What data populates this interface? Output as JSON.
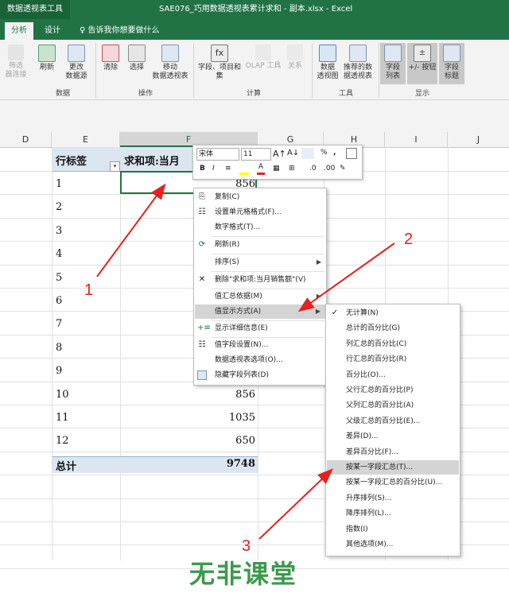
{
  "titlebar": {
    "context_tab": "数据透视表工具",
    "title": "SAE076_巧用数据透视表累计求和 - 副本.xlsx  -  Excel"
  },
  "tabs": {
    "analyze": "分析",
    "design": "设计",
    "tell_me": "告诉我你想要做什么"
  },
  "ribbon": {
    "filter_connections": "筛选\n器连接",
    "refresh": "刷新",
    "change_source": "更改\n数据源",
    "clear": "清除",
    "select": "选择",
    "move_pivot": "移动\n数据透视表",
    "fields_items_sets": "字段、项目和\n集",
    "olap_tools": "OLAP 工具",
    "relationships": "关系",
    "pivot_chart": "数据\n透视图",
    "recommended_pivot": "推荐的数\n据透视表",
    "field_list": "字段\n列表",
    "buttons": "+/- 按钮",
    "field_headers": "字段\n标题",
    "group_data": "数据",
    "group_actions": "操作",
    "group_calc": "计算",
    "group_tools": "工具",
    "group_show": "显示"
  },
  "columns": [
    "D",
    "E",
    "F",
    "G",
    "H",
    "I",
    "J"
  ],
  "pivot": {
    "row_label": "行标签",
    "value_header": "求和项:当月",
    "rows": [
      {
        "label": "1",
        "value": "856"
      },
      {
        "label": "2",
        "value": ""
      },
      {
        "label": "3",
        "value": ""
      },
      {
        "label": "4",
        "value": ""
      },
      {
        "label": "5",
        "value": ""
      },
      {
        "label": "6",
        "value": ""
      },
      {
        "label": "7",
        "value": ""
      },
      {
        "label": "8",
        "value": ""
      },
      {
        "label": "9",
        "value": ""
      },
      {
        "label": "10",
        "value": "856"
      },
      {
        "label": "11",
        "value": "1035"
      },
      {
        "label": "12",
        "value": "650"
      }
    ],
    "total_label": "总计",
    "total_value": "9748"
  },
  "minibar": {
    "font": "宋体",
    "size": "11",
    "bold": "B",
    "italic": "I",
    "percent": "%",
    "comma": ","
  },
  "context_menu": {
    "copy": "复制(C)",
    "format_cells": "设置单元格格式(F)...",
    "number_format": "数字格式(T)...",
    "refresh": "刷新(R)",
    "sort": "排序(S)",
    "remove": "删除\"求和项:当月销售额\"(V)",
    "summarize_by": "值汇总依据(M)",
    "show_values_as": "值显示方式(A)",
    "show_details": "显示详细信息(E)",
    "value_field_settings": "值字段设置(N)...",
    "pivot_options": "数据透视表选项(O)...",
    "hide_field_list": "隐藏字段列表(D)"
  },
  "submenu": {
    "items": [
      "无计算(N)",
      "总计的百分比(G)",
      "列汇总的百分比(C)",
      "行汇总的百分比(R)",
      "百分比(O)...",
      "父行汇总的百分比(P)",
      "父列汇总的百分比(A)",
      "父级汇总的百分比(E)...",
      "差异(D)...",
      "差异百分比(F)...",
      "按某一字段汇总(T)...",
      "按某一字段汇总的百分比(U)...",
      "升序排列(S)...",
      "降序排列(L)...",
      "指数(I)",
      "其他选项(M)..."
    ]
  },
  "annotations": [
    "1",
    "2",
    "3"
  ],
  "watermark": "无非课堂",
  "colors": {
    "excel_green": "#217346",
    "pivot_header": "#dce6f1",
    "arrow_red": "#e8201f",
    "watermark_green": "#3c9a4c"
  }
}
